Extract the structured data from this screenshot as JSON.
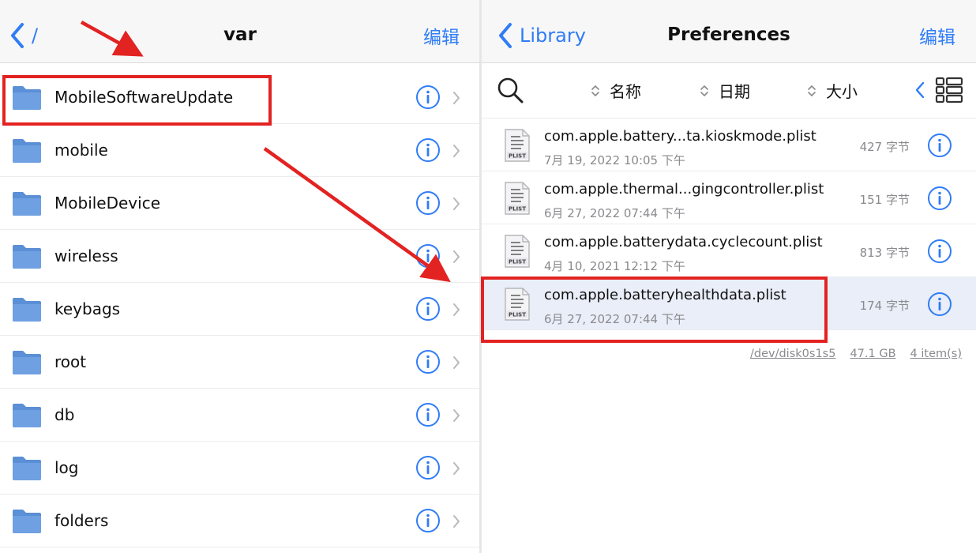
{
  "left_pane": {
    "back_label": "/",
    "title": "var",
    "edit_label": "编辑",
    "folders": [
      {
        "name": "MobileSoftwareUpdate"
      },
      {
        "name": "mobile"
      },
      {
        "name": "MobileDevice"
      },
      {
        "name": "wireless"
      },
      {
        "name": "keybags"
      },
      {
        "name": "root"
      },
      {
        "name": "db"
      },
      {
        "name": "log"
      },
      {
        "name": "folders"
      }
    ]
  },
  "right_pane": {
    "back_label": "Library",
    "title": "Preferences",
    "edit_label": "编辑",
    "sort": {
      "name_label": "名称",
      "date_label": "日期",
      "size_label": "大小"
    },
    "files": [
      {
        "name": "com.apple.battery...ta.kioskmode.plist",
        "date": "7月 19, 2022 10:05 下午",
        "size": "427 字节",
        "selected": false
      },
      {
        "name": "com.apple.thermal...gingcontroller.plist",
        "date": "6月 27, 2022 07:44 下午",
        "size": "151 字节",
        "selected": false
      },
      {
        "name": "com.apple.batterydata.cyclecount.plist",
        "date": "4月 10, 2021 12:12 下午",
        "size": "813 字节",
        "selected": false
      },
      {
        "name": "com.apple.batteryhealthdata.plist",
        "date": "6月 27, 2022 07:44 下午",
        "size": "174 字节",
        "selected": true
      }
    ],
    "footer": {
      "disk": "/dev/disk0s1s5",
      "capacity": "47.1 GB",
      "count": "4 item(s)"
    }
  },
  "icons": {
    "folder": "folder-icon",
    "info": "info-icon",
    "chevron": "chevron-right-icon",
    "file": "plist-file-icon",
    "search": "search-icon",
    "grid": "grid-view-icon"
  },
  "colors": {
    "accent": "#2f7cf6",
    "folder": "#5b8fd6",
    "annotation": "#e32222",
    "selected_row": "#e9eef9"
  }
}
